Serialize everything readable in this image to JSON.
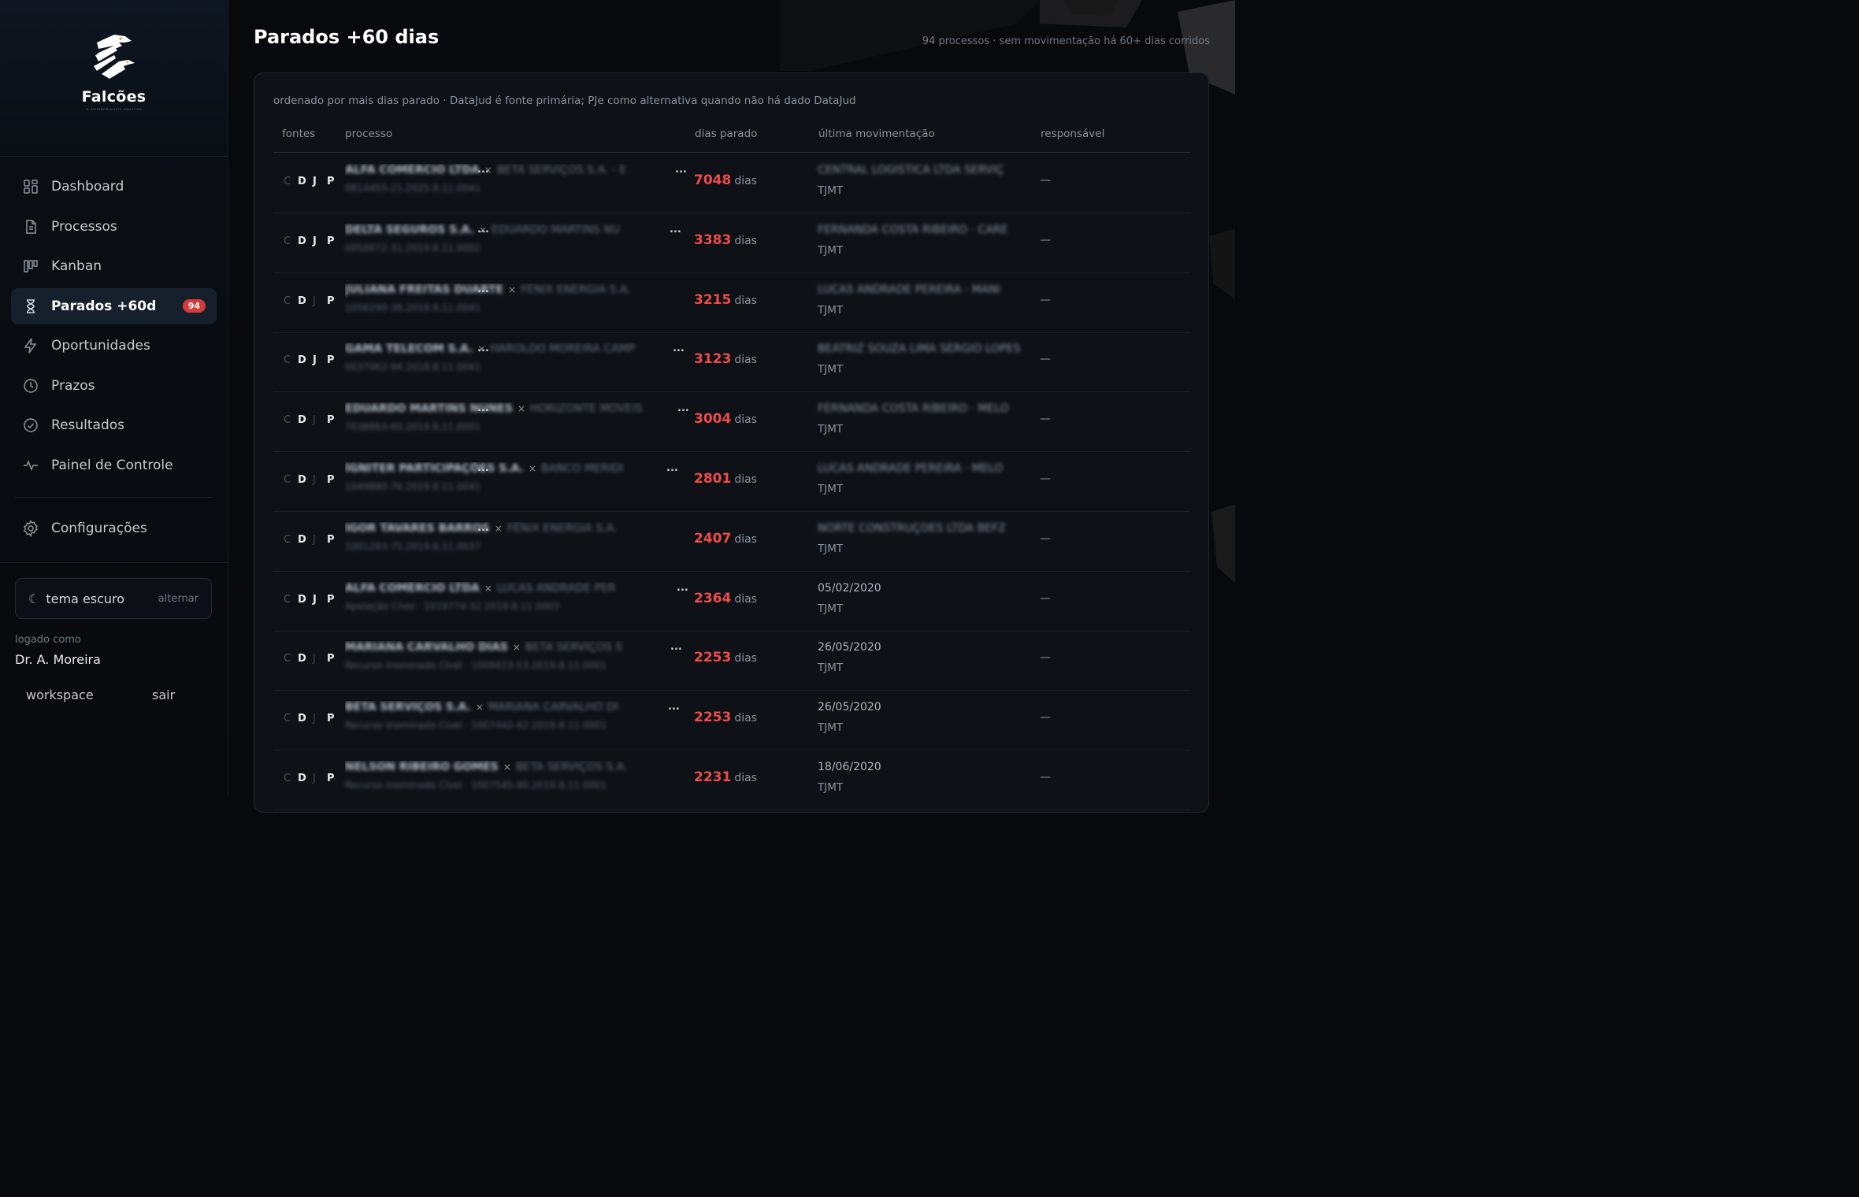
{
  "brand": {
    "name": "Falcões",
    "tagline": "IA PATRIMONIALISTA ASSISTIDA"
  },
  "nav": [
    {
      "label": "Dashboard",
      "icon": "grid-icon"
    },
    {
      "label": "Processos",
      "icon": "document-icon"
    },
    {
      "label": "Kanban",
      "icon": "kanban-icon"
    },
    {
      "label": "Parados +60d",
      "icon": "hourglass-icon",
      "active": true,
      "badge": "94"
    },
    {
      "label": "Oportunidades",
      "icon": "lightning-icon"
    },
    {
      "label": "Prazos",
      "icon": "clock-icon"
    },
    {
      "label": "Resultados",
      "icon": "check-circle-icon"
    },
    {
      "label": "Painel de Controle",
      "icon": "activity-icon"
    }
  ],
  "settings": {
    "label": "Configurações",
    "icon": "gear-icon"
  },
  "theme": {
    "label": "tema escuro",
    "toggle": "alternar",
    "icon": "moon-icon"
  },
  "user": {
    "logged_label": "logado como",
    "name": "Dr. A. Moreira",
    "workspace": "workspace",
    "logout": "sair"
  },
  "page": {
    "title": "Parados +60 dias",
    "subtitle": "94 processos · sem movimentação há 60+ dias corridos",
    "note": "ordenado por mais dias parado · DataJud é fonte primária; PJe como alternativa quando não há dado DataJud"
  },
  "table": {
    "headers": {
      "fontes": "fontes",
      "processo": "processo",
      "dias": "dias parado",
      "ultima": "última movimentação",
      "responsavel": "responsável"
    },
    "sources": {
      "c": "C",
      "d": "D",
      "j": "J",
      "p": "P"
    },
    "days_unit": "dias",
    "times_sep": "×",
    "ellipsis": "...",
    "rows": [
      {
        "party_a": "ALFA COMÉRCIO LTDA",
        "party_b": "BETA SERVIÇOS S.A. - E",
        "proc_id": "0814455-21.2025.8.11.0041",
        "days": "7048",
        "last": "CENTRAL LOGÍSTICA LTDA SERVIÇ",
        "last_blurred": true,
        "court": "TJMT",
        "resp": "—",
        "j_active": true
      },
      {
        "party_a": "DELTA SEGUROS S.A.",
        "party_b": "EDUARDO MARTINS NU",
        "proc_id": "0050072-31.2019.8.11.0002",
        "days": "3383",
        "last": "FERNANDA COSTA RIBEIRO · CARE",
        "last_blurred": true,
        "court": "TJMT",
        "resp": "—",
        "j_active": true
      },
      {
        "party_a": "JULIANA FREITAS DUARTE",
        "party_b": "FÊNIX ENERGIA S.A.",
        "proc_id": "1056290-38.2019.8.11.0041",
        "days": "3215",
        "last": "LUCAS ANDRADE PEREIRA · MANI",
        "last_blurred": true,
        "court": "TJMT",
        "resp": "—",
        "j_active": false
      },
      {
        "party_a": "GAMA TELECOM S.A.",
        "party_b": "HAROLDO MOREIRA CAMP",
        "proc_id": "0037062-94.2018.8.11.0041",
        "days": "3123",
        "last": "BEATRIZ SOUZA LIMA SERGIO LOPES",
        "last_blurred": true,
        "court": "TJMT",
        "resp": "—",
        "j_active": true
      },
      {
        "party_a": "EDUARDO MARTINS NUNES",
        "party_b": "HORIZONTE MÓVEIS",
        "proc_id": "7038863-60.2019.8.11.0001",
        "days": "3004",
        "last": "FERNANDA COSTA RIBEIRO · MELO",
        "last_blurred": true,
        "court": "TJMT",
        "resp": "—",
        "j_active": false
      },
      {
        "party_a": "ÍGNITER PARTICIPAÇÕES S.A.",
        "party_b": "BANCO MERIDI",
        "proc_id": "1049880-76.2019.8.11.0041",
        "days": "2801",
        "last": "LUCAS ANDRADE PEREIRA · MELO",
        "last_blurred": true,
        "court": "TJMT",
        "resp": "—",
        "j_active": false
      },
      {
        "party_a": "IGOR TAVARES BARROS",
        "party_b": "FÊNIX ENERGIA S.A.",
        "proc_id": "1001283-75.2019.8.11.0037",
        "days": "2407",
        "last": "NORTE CONSTRUÇÕES LTDA BEFZ",
        "last_blurred": true,
        "court": "TJMT",
        "resp": "—",
        "j_active": false
      },
      {
        "party_a": "ALFA COMÉRCIO LTDA",
        "party_b": "LUCAS ANDRADE PER",
        "proc_id": "Apelação Cível · 1019774-32.2019.8.11.0003",
        "days": "2364",
        "last": "05/02/2020",
        "last_blurred": false,
        "court": "TJMT",
        "resp": "—",
        "j_active": true
      },
      {
        "party_a": "MARIANA CARVALHO DIAS",
        "party_b": "BETA SERVIÇOS S",
        "proc_id": "Recurso Inominado Cível · 1009423-53.2019.8.11.0001",
        "days": "2253",
        "last": "26/05/2020",
        "last_blurred": false,
        "court": "TJMT",
        "resp": "—",
        "j_active": false
      },
      {
        "party_a": "BETA SERVIÇOS S.A.",
        "party_b": "MARIANA CARVALHO DI",
        "proc_id": "Recurso Inominado Cível · 1007442-42.2019.8.11.0001",
        "days": "2253",
        "last": "26/05/2020",
        "last_blurred": false,
        "court": "TJMT",
        "resp": "—",
        "j_active": false
      },
      {
        "party_a": "NELSON RIBEIRO GOMES",
        "party_b": "BETA SERVIÇOS S.A.",
        "proc_id": "Recurso Inominado Cível · 1007545-90.2019.8.11.0001",
        "days": "2231",
        "last": "18/06/2020",
        "last_blurred": false,
        "court": "TJMT",
        "resp": "—",
        "j_active": false
      }
    ]
  }
}
